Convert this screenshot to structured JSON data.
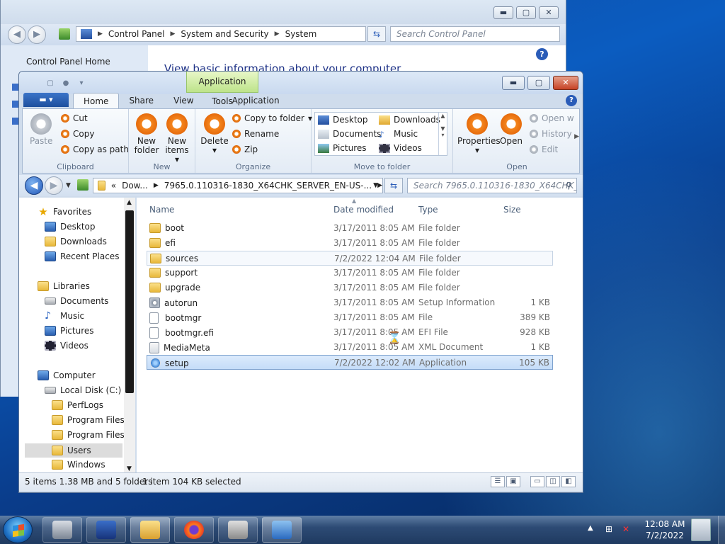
{
  "control_panel": {
    "address": [
      "Control Panel",
      "System and Security",
      "System"
    ],
    "search_placeholder": "Search Control Panel",
    "home_link": "Control Panel Home",
    "heading": "View basic information about your computer"
  },
  "explorer": {
    "context_tab": "Application Tools",
    "tabs": [
      "Home",
      "Share",
      "View"
    ],
    "context_subtab": "Application",
    "ribbon": {
      "clipboard": {
        "label": "Clipboard",
        "paste": "Paste",
        "cut": "Cut",
        "copy": "Copy",
        "copy_path": "Copy as path"
      },
      "new": {
        "label": "New",
        "new_folder": "New folder",
        "new_items": "New items"
      },
      "organize": {
        "label": "Organize",
        "delete": "Delete",
        "copy_to": "Copy to folder",
        "rename": "Rename",
        "zip": "Zip"
      },
      "move_to": {
        "label": "Move to folder",
        "items": [
          "Desktop",
          "Downloads",
          "Documents",
          "Music",
          "Pictures",
          "Videos"
        ]
      },
      "open": {
        "label": "Open",
        "properties": "Properties",
        "open": "Open",
        "open_with": "Open w",
        "history": "History",
        "edit": "Edit"
      }
    },
    "address": {
      "prefix": "«",
      "parts": [
        "Dow...",
        "7965.0.110316-1830_X64CHK_SERVER_EN-US-..."
      ]
    },
    "search_placeholder": "Search 7965.0.110316-1830_X64CHK_S...",
    "nav": {
      "favorites": "Favorites",
      "fav_items": [
        "Desktop",
        "Downloads",
        "Recent Places"
      ],
      "libraries": "Libraries",
      "lib_items": [
        "Documents",
        "Music",
        "Pictures",
        "Videos"
      ],
      "computer": "Computer",
      "drive": "Local Disk (C:)",
      "drive_items": [
        "PerfLogs",
        "Program Files",
        "Program Files (",
        "Users",
        "Windows"
      ]
    },
    "columns": {
      "name": "Name",
      "date": "Date modified",
      "type": "Type",
      "size": "Size"
    },
    "files": [
      {
        "name": "boot",
        "date": "3/17/2011 8:05 AM",
        "type": "File folder",
        "size": ""
      },
      {
        "name": "efi",
        "date": "3/17/2011 8:05 AM",
        "type": "File folder",
        "size": ""
      },
      {
        "name": "sources",
        "date": "7/2/2022 12:04 AM",
        "type": "File folder",
        "size": ""
      },
      {
        "name": "support",
        "date": "3/17/2011 8:05 AM",
        "type": "File folder",
        "size": ""
      },
      {
        "name": "upgrade",
        "date": "3/17/2011 8:05 AM",
        "type": "File folder",
        "size": ""
      },
      {
        "name": "autorun",
        "date": "3/17/2011 8:05 AM",
        "type": "Setup Information",
        "size": "1 KB"
      },
      {
        "name": "bootmgr",
        "date": "3/17/2011 8:05 AM",
        "type": "File",
        "size": "389 KB"
      },
      {
        "name": "bootmgr.efi",
        "date": "3/17/2011 8:05 AM",
        "type": "EFI File",
        "size": "928 KB"
      },
      {
        "name": "MediaMeta",
        "date": "3/17/2011 8:05 AM",
        "type": "XML Document",
        "size": "1 KB"
      },
      {
        "name": "setup",
        "date": "7/2/2022 12:02 AM",
        "type": "Application",
        "size": "105 KB"
      }
    ],
    "status": {
      "count": "5 items 1.38 MB and 5 folders",
      "selection": "1 item 104 KB selected"
    }
  },
  "taskbar": {
    "time": "12:08 AM",
    "date": "7/2/2022"
  }
}
